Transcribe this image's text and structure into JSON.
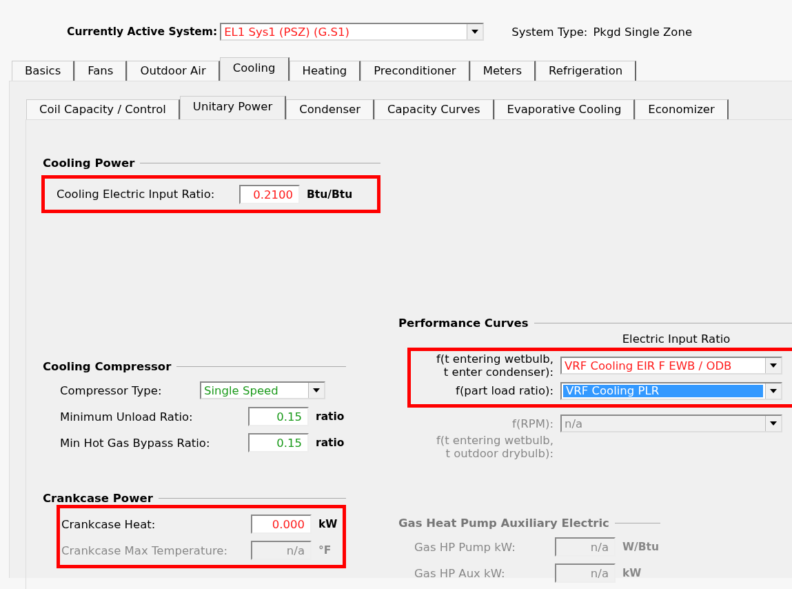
{
  "header": {
    "label": "Currently Active System:",
    "system": "EL1 Sys1 (PSZ) (G.S1)",
    "system_type_label": "System Type:",
    "system_type": "Pkgd Single Zone"
  },
  "tabs": [
    {
      "label": "Basics",
      "selected": false
    },
    {
      "label": "Fans",
      "selected": false
    },
    {
      "label": "Outdoor Air",
      "selected": false
    },
    {
      "label": "Cooling",
      "selected": true
    },
    {
      "label": "Heating",
      "selected": false
    },
    {
      "label": "Preconditioner",
      "selected": false
    },
    {
      "label": "Meters",
      "selected": false
    },
    {
      "label": "Refrigeration",
      "selected": false
    }
  ],
  "subtabs": [
    {
      "label": "Coil Capacity / Control",
      "selected": false
    },
    {
      "label": "Unitary Power",
      "selected": true
    },
    {
      "label": "Condenser",
      "selected": false
    },
    {
      "label": "Capacity Curves",
      "selected": false
    },
    {
      "label": "Evaporative Cooling",
      "selected": false
    },
    {
      "label": "Economizer",
      "selected": false
    }
  ],
  "cooling_power": {
    "title": "Cooling Power",
    "disabled": false,
    "groups": [
      {
        "highlighted": true,
        "fields": [
          {
            "kind": "input",
            "label": "Cooling Electric Input Ratio:",
            "value": "0.2100",
            "unit": "Btu/Btu",
            "user_defined": true,
            "disabled": false
          }
        ]
      }
    ]
  },
  "performance_curves": {
    "title": "Performance Curves",
    "column_heading": "Electric Input Ratio",
    "disabled": false,
    "groups": [
      {
        "highlighted": true,
        "fields": [
          {
            "kind": "dropdown",
            "label": "f(t entering wetbulb,\nt enter condenser):",
            "value": "VRF Cooling EIR F EWB / ODB",
            "user_defined": true,
            "disabled": false,
            "focused": false
          },
          {
            "kind": "dropdown",
            "label": "f(part load ratio):",
            "value": "VRF Cooling PLR",
            "user_defined": true,
            "disabled": false,
            "focused": true
          }
        ]
      },
      {
        "highlighted": false,
        "fields": [
          {
            "kind": "dropdown",
            "label": "f(RPM):",
            "value": "n/a",
            "disabled": true,
            "focused": false
          },
          {
            "kind": "label",
            "label": "f(t entering wetbulb,\nt outdoor drybulb):",
            "disabled": true
          }
        ]
      }
    ]
  },
  "cooling_compressor": {
    "title": "Cooling Compressor",
    "disabled": false,
    "groups": [
      {
        "highlighted": false,
        "fields": [
          {
            "kind": "dropdown",
            "label": "Compressor Type:",
            "value": "Single Speed",
            "user_defined": false,
            "disabled": false,
            "focused": false
          },
          {
            "kind": "input",
            "label": "Minimum Unload Ratio:",
            "value": "0.15",
            "unit": "ratio",
            "user_defined": false,
            "disabled": false
          },
          {
            "kind": "input",
            "label": "Min Hot Gas Bypass Ratio:",
            "value": "0.15",
            "unit": "ratio",
            "user_defined": false,
            "disabled": false
          }
        ]
      }
    ]
  },
  "crankcase_power": {
    "title": "Crankcase Power",
    "disabled": false,
    "groups": [
      {
        "highlighted": true,
        "fields": [
          {
            "kind": "input",
            "label": "Crankcase Heat:",
            "value": "0.000",
            "unit": "kW",
            "user_defined": true,
            "disabled": false
          },
          {
            "kind": "input",
            "label": "Crankcase Max Temperature:",
            "value": "n/a",
            "unit": "°F",
            "disabled": true
          }
        ]
      }
    ]
  },
  "gas_heat_pump_auxiliary": {
    "title": "Gas Heat Pump Auxiliary Electric",
    "disabled": true,
    "groups": [
      {
        "highlighted": false,
        "fields": [
          {
            "kind": "input",
            "label": "Gas HP Pump kW:",
            "value": "n/a",
            "unit": "W/Btu",
            "disabled": true
          },
          {
            "kind": "input",
            "label": "Gas HP Aux kW:",
            "value": "n/a",
            "unit": "kW",
            "disabled": true
          }
        ]
      }
    ]
  }
}
